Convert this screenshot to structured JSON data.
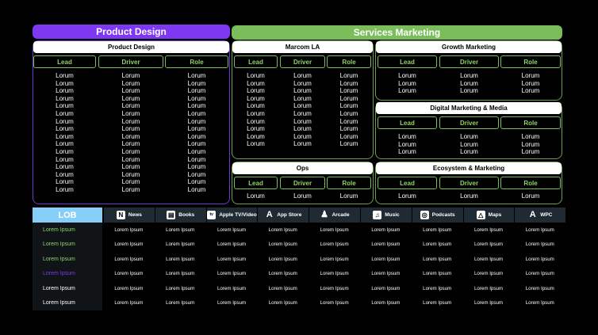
{
  "banners": {
    "product_design": "Product Design",
    "services_marketing": "Services Marketing"
  },
  "headers": {
    "lead": "Lead",
    "driver": "Driver",
    "role": "Role"
  },
  "filler": "Lorum",
  "sections": {
    "product_design": {
      "title": "Product Design"
    },
    "marcom_la": {
      "title": "Marcom LA"
    },
    "growth_marketing": {
      "title": "Growth Marketing"
    },
    "digital_marketing_media": {
      "title": "Digital Marketing & Media"
    },
    "ops": {
      "title": "Ops"
    },
    "ecosystem_marketing": {
      "title": "Ecosystem & Marketing"
    }
  },
  "lob": {
    "header": "LOB",
    "apps": [
      {
        "label": "News",
        "icon": "news-icon"
      },
      {
        "label": "Books",
        "icon": "books-icon"
      },
      {
        "label": "Apple TV/Video",
        "icon": "apple-tv-icon"
      },
      {
        "label": "App Store",
        "icon": "app-store-icon"
      },
      {
        "label": "Arcade",
        "icon": "arcade-icon"
      },
      {
        "label": "Music",
        "icon": "music-icon"
      },
      {
        "label": "Podcasts",
        "icon": "podcasts-icon"
      },
      {
        "label": "Maps",
        "icon": "maps-icon"
      },
      {
        "label": "WPC",
        "icon": "wpc-icon"
      }
    ],
    "rows": [
      {
        "label": "Lorem Ipsum",
        "color": "#8fd36a"
      },
      {
        "label": "Lorem Ipsum",
        "color": "#8fd36a"
      },
      {
        "label": "Lorem Ipsum",
        "color": "#8fd36a"
      },
      {
        "label": "Lorem Ipsum",
        "color": "#7f38f2"
      },
      {
        "label": "Lorem Ipsum",
        "color": "#ffffff"
      },
      {
        "label": "Lorem Ipsum",
        "color": "#ffffff"
      }
    ],
    "cell_text": "Lorem Ipsum"
  },
  "colors": {
    "purple": "#7f38f2",
    "green": "#7bbd5a",
    "lob_header": "#87cef8",
    "app_header": "#1f2a33"
  }
}
